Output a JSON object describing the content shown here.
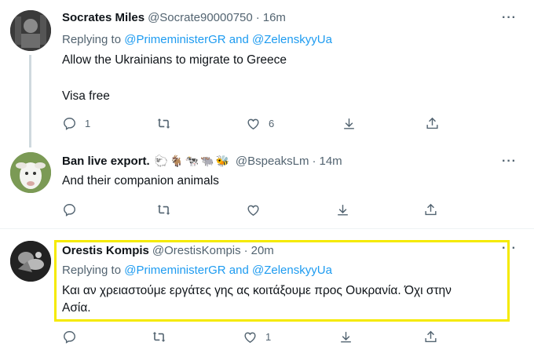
{
  "tweets": [
    {
      "name": "Socrates Miles",
      "handle": "@Socrate90000750",
      "time": "16m",
      "replying_prefix": "Replying to",
      "replying_to": "@PrimeministerGR and @ZelenskyyUa",
      "text_lines": [
        "Allow the Ukrainians to migrate to Greece",
        "Visa free"
      ],
      "reply_count": "1",
      "retweet_count": "",
      "like_count": "6"
    },
    {
      "name": "Ban live export.",
      "emoji": [
        "🐑",
        "🐐",
        "🐄",
        "🐃",
        "🐝"
      ],
      "handle": "@BspeaksLm",
      "time": "14m",
      "text_lines": [
        "And their companion animals"
      ],
      "reply_count": "",
      "retweet_count": "",
      "like_count": ""
    },
    {
      "name": "Orestis Kompis",
      "handle": "@OrestisKompis",
      "time": "20m",
      "replying_prefix": "Replying to",
      "replying_to": "@PrimeministerGR and @ZelenskyyUa",
      "text_lines": [
        "Και αν χρειαστούμε εργάτες γης ας κοιτάξουμε προς Ουκρανία. Όχι στην",
        "Ασία."
      ],
      "reply_count": "",
      "retweet_count": "",
      "like_count": "1"
    }
  ],
  "separator": "·",
  "more_label": "···",
  "colors": {
    "highlight": "#f5ea00",
    "link": "#1d9bf0",
    "muted": "#536471"
  },
  "icons": [
    "reply-icon",
    "retweet-icon",
    "like-icon",
    "download-icon",
    "share-icon",
    "more-icon"
  ]
}
